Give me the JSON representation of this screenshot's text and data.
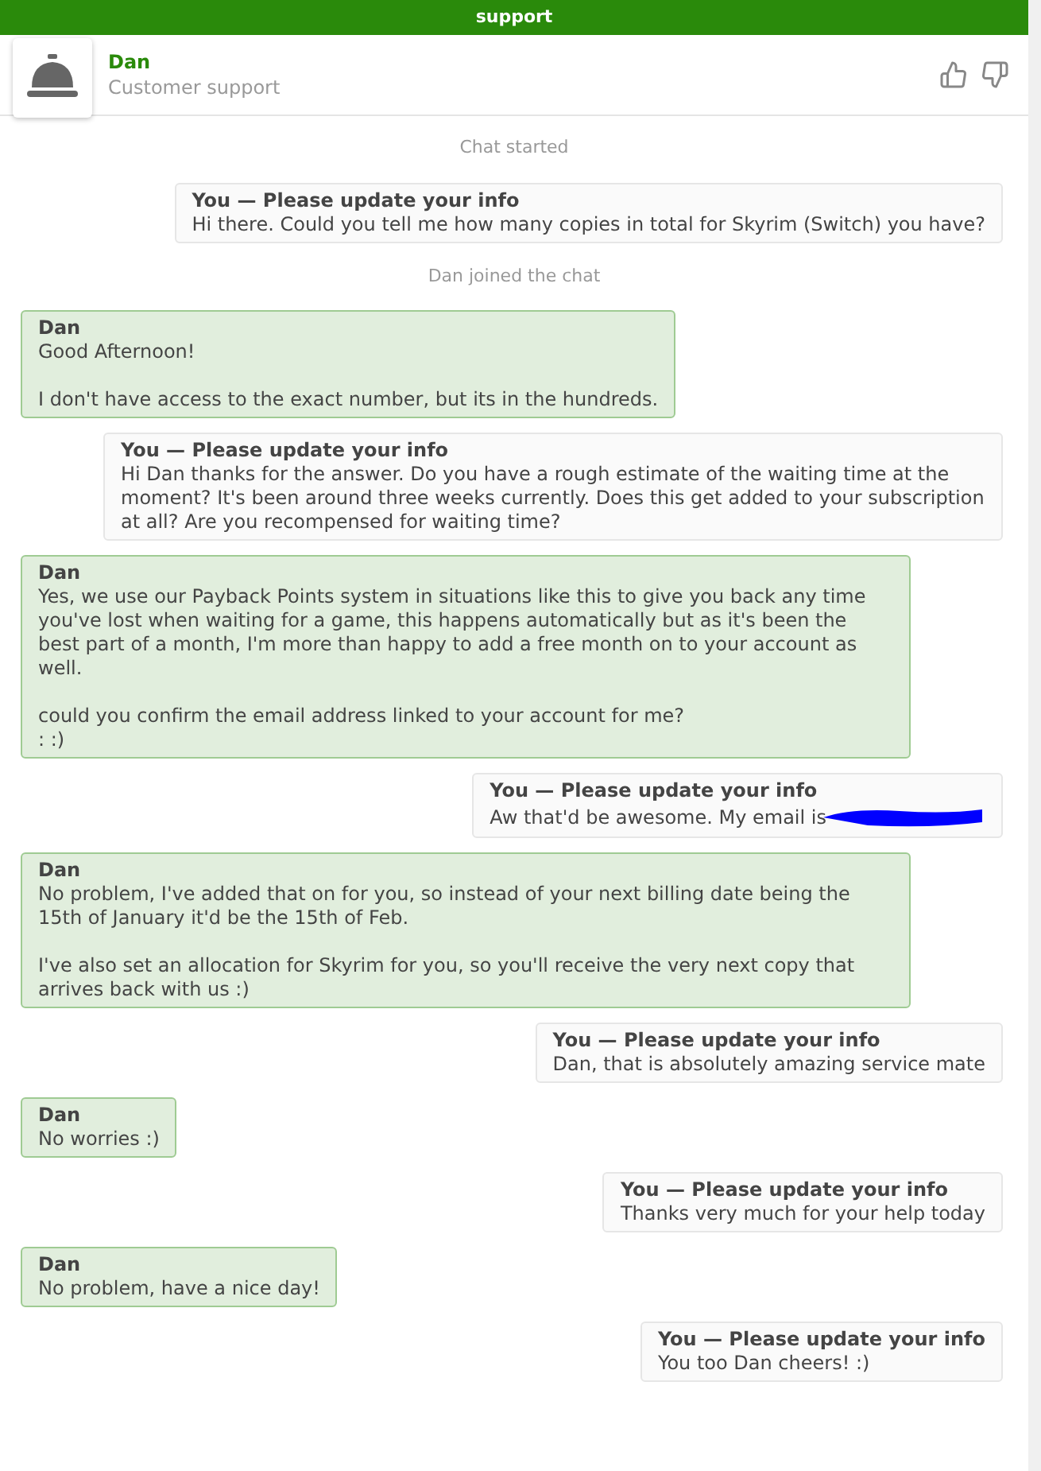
{
  "top_bar": {
    "title": "support"
  },
  "header": {
    "name": "Dan",
    "subtitle": "Customer support"
  },
  "messages": [
    {
      "kind": "system",
      "text": "Chat started"
    },
    {
      "kind": "user",
      "sender": "You — Please update your info",
      "text": "Hi there. Could you tell me how many copies in total for Skyrim (Switch) you have?"
    },
    {
      "kind": "system",
      "text": "Dan joined the chat"
    },
    {
      "kind": "agent",
      "sender": "Dan",
      "text": "Good Afternoon!\n\nI don't have access to the exact number, but its in the hundreds."
    },
    {
      "kind": "user",
      "sender": "You — Please update your info",
      "text": "Hi Dan thanks for the answer. Do you have a rough estimate of the waiting time at the moment? It's been around three weeks currently. Does this get added to your subscription at all? Are you recompensed for waiting time?"
    },
    {
      "kind": "agent",
      "sender": "Dan",
      "text": "Yes, we use our Payback Points system in situations like this to give you back any time you've lost when waiting for a game, this happens automatically but as it's been the best part of a month, I'm more than happy to add a free month on to your account as well.\n\ncould you confirm the email address linked to your account for me?\n: :)"
    },
    {
      "kind": "user",
      "sender": "You — Please update your info",
      "text": "Aw that'd be awesome. My email is",
      "redacted": true
    },
    {
      "kind": "agent",
      "sender": "Dan",
      "text": "No problem, I've added that on for you, so instead of your next billing date being the 15th of January it'd be the 15th of Feb.\n\nI've also set an allocation for Skyrim for you, so you'll receive the very next copy that arrives back with us :)"
    },
    {
      "kind": "user",
      "sender": "You — Please update your info",
      "text": "Dan, that is absolutely amazing service mate"
    },
    {
      "kind": "agent",
      "sender": "Dan",
      "text": "No worries :)"
    },
    {
      "kind": "user",
      "sender": "You — Please update your info",
      "text": "Thanks very much for your help today"
    },
    {
      "kind": "agent",
      "sender": "Dan",
      "text": "No problem, have a nice day!"
    },
    {
      "kind": "user",
      "sender": "You — Please update your info",
      "text": "You too Dan cheers! :)"
    }
  ]
}
